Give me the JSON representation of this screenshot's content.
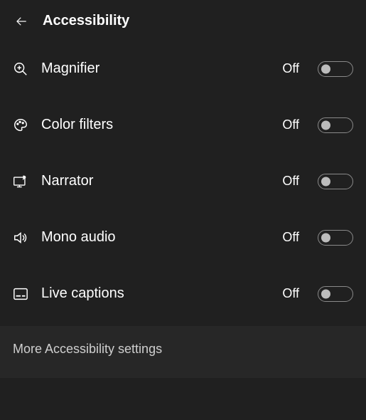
{
  "header": {
    "title": "Accessibility"
  },
  "items": [
    {
      "icon": "magnifier",
      "label": "Magnifier",
      "status": "Off",
      "on": false
    },
    {
      "icon": "color-filters",
      "label": "Color filters",
      "status": "Off",
      "on": false
    },
    {
      "icon": "narrator",
      "label": "Narrator",
      "status": "Off",
      "on": false
    },
    {
      "icon": "mono-audio",
      "label": "Mono audio",
      "status": "Off",
      "on": false
    },
    {
      "icon": "live-captions",
      "label": "Live captions",
      "status": "Off",
      "on": false
    }
  ],
  "footer": {
    "more_link": "More Accessibility settings"
  }
}
